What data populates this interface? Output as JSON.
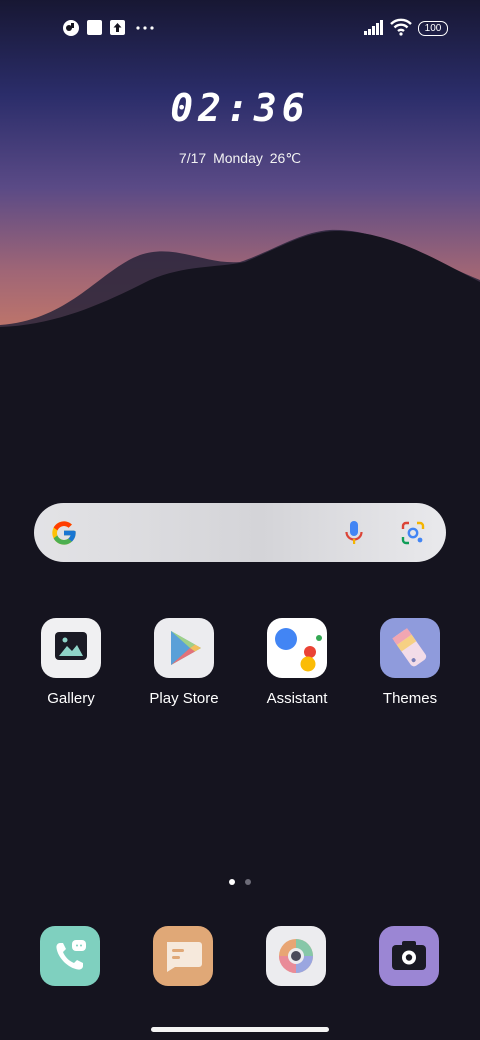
{
  "status_bar": {
    "notification_icons": [
      "app-notification-icon",
      "square-notification-icon",
      "upload-notification-icon",
      "more-dots-icon"
    ],
    "signal_icon": "signal-bars-icon",
    "wifi_icon": "wifi-icon",
    "battery_level": "100"
  },
  "clock_widget": {
    "time": "02:36",
    "date": "7/17",
    "weekday": "Monday",
    "temperature": "26℃"
  },
  "search_bar": {
    "logo_icon": "google-g-icon",
    "mic_icon": "microphone-icon",
    "lens_icon": "google-lens-icon"
  },
  "apps": [
    {
      "label": "Gallery",
      "icon": "gallery-icon"
    },
    {
      "label": "Play Store",
      "icon": "play-store-icon"
    },
    {
      "label": "Assistant",
      "icon": "assistant-icon"
    },
    {
      "label": "Themes",
      "icon": "themes-icon"
    }
  ],
  "page_indicator": {
    "total_pages": 2,
    "current_page": 1
  },
  "dock": [
    {
      "icon": "phone-icon"
    },
    {
      "icon": "messages-icon"
    },
    {
      "icon": "browser-icon"
    },
    {
      "icon": "camera-icon"
    }
  ],
  "colors": {
    "background": "#15141f",
    "mountain": "#121119",
    "sky_top": "#1a1b4a",
    "sky_glow": "#b56d73"
  }
}
